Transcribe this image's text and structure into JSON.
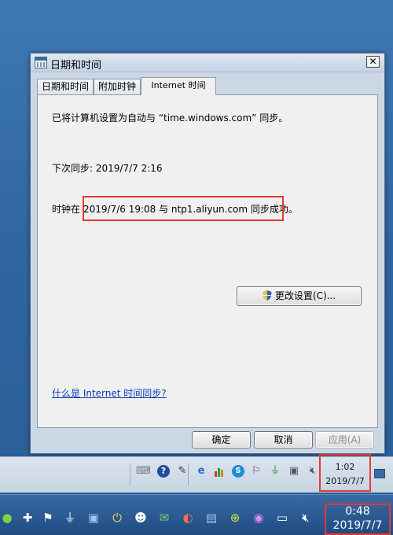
{
  "dialog": {
    "title": "日期和时间",
    "close_glyph": "✕",
    "tabs": [
      {
        "label": "日期和时间"
      },
      {
        "label": "附加时钟"
      },
      {
        "label": "Internet 时间"
      }
    ],
    "active_tab": "Internet 时间",
    "line1": "已将计算机设置为自动与 “time.windows.com” 同步。",
    "next_sync": "下次同步: 2019/7/7 2:16",
    "sync_prefix": "时钟在 ",
    "sync_highlight": "2019/7/6 19:08 与 ntp1.aliyun.com 同步成功。",
    "change_settings": "更改设置(C)...",
    "help_link": "什么是 Internet 时间同步?",
    "ok": "确定",
    "cancel": "取消",
    "apply": "应用(A)"
  },
  "inner_taskbar": {
    "clock_time": "1:02",
    "clock_date": "2019/7/7",
    "icons": [
      "keyboard-icon",
      "help-icon",
      "pen-icon",
      "ie-icon",
      "chart-icon",
      "shield-s-icon",
      "flag-icon",
      "usb-icon",
      "network-icon",
      "volume-mute-icon"
    ]
  },
  "outer_taskbar": {
    "clock_time": "0:48",
    "clock_date": "2019/7/7",
    "icons": [
      "app-icon",
      "antivirus-icon",
      "flag-icon",
      "usb-icon",
      "network-icon",
      "plug-icon",
      "qq-icon",
      "wechat-icon",
      "browser-icon",
      "network-icon",
      "plus-icon",
      "media-icon",
      "monitor-icon",
      "volume-mute-icon"
    ]
  },
  "colors": {
    "highlight_red": "#e53935",
    "link_blue": "#0e3bb5",
    "desktop_blue": "#2f66a3"
  }
}
